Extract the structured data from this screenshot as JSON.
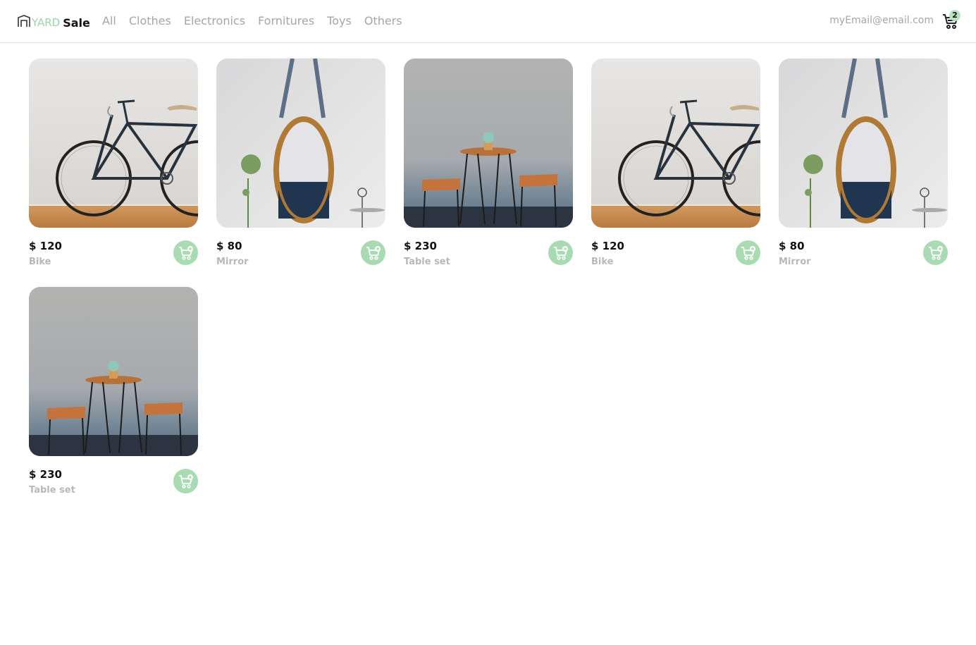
{
  "brand": {
    "yard": "YARD",
    "sale": "Sale"
  },
  "nav": {
    "categories": [
      "All",
      "Clothes",
      "Electronics",
      "Fornitures",
      "Toys",
      "Others"
    ]
  },
  "user": {
    "email": "myEmail@email.com"
  },
  "cart": {
    "count": "2"
  },
  "colors": {
    "accent": "#a8dbb1",
    "brand_green": "#9fd3a9",
    "muted_text": "#a6a6a6"
  },
  "products": [
    {
      "price": "$ 120",
      "name": "Bike",
      "image": "bike"
    },
    {
      "price": "$ 80",
      "name": "Mirror",
      "image": "mirror"
    },
    {
      "price": "$ 230",
      "name": "Table set",
      "image": "table-set"
    },
    {
      "price": "$ 120",
      "name": "Bike",
      "image": "bike"
    },
    {
      "price": "$ 80",
      "name": "Mirror",
      "image": "mirror"
    },
    {
      "price": "$ 230",
      "name": "Table set",
      "image": "table-set"
    }
  ]
}
